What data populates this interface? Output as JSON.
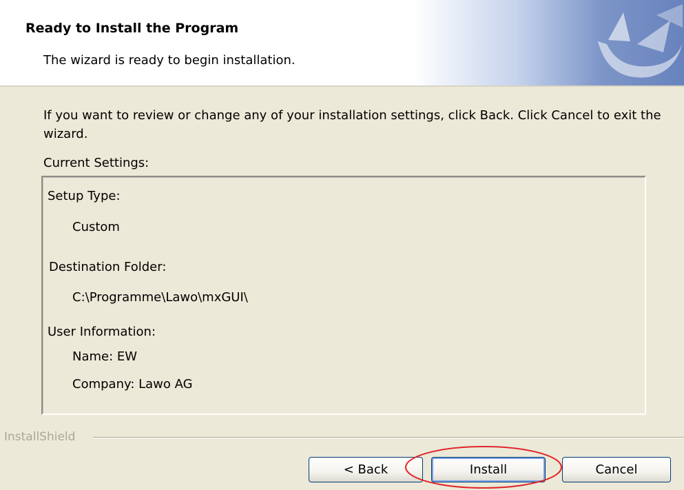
{
  "header": {
    "title": "Ready to Install the Program",
    "subtitle": "The wizard is ready to begin installation."
  },
  "intro_text": "If you want to review or change any of your installation settings, click Back. Click Cancel to exit the wizard.",
  "current_settings_label": "Current Settings:",
  "settings": {
    "setup_type_label": "Setup Type:",
    "setup_type_value": "Custom",
    "destination_label": "Destination Folder:",
    "destination_value": "C:\\Programme\\Lawo\\mxGUI\\",
    "user_info_label": "User Information:",
    "user_name": "Name: EW",
    "user_company": "Company: Lawo AG"
  },
  "footer": {
    "brand": "InstallShield",
    "back_label": "< Back",
    "install_label": "Install",
    "cancel_label": "Cancel"
  },
  "colors": {
    "dialog_bg": "#ece9d8",
    "highlight_ring": "#e0262b",
    "button_border": "#003c74"
  }
}
